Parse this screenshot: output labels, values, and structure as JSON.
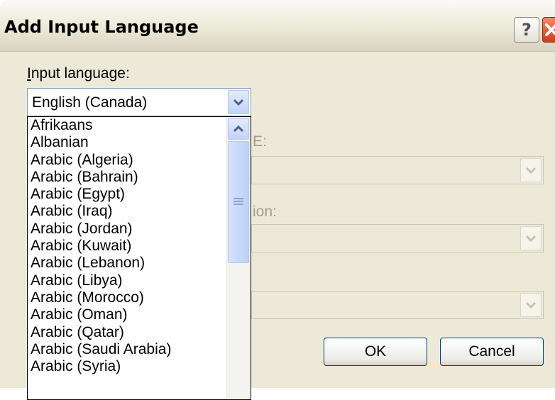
{
  "dialog": {
    "title": "Add Input Language",
    "help_button": "?"
  },
  "input_language": {
    "label_mnemonic": "I",
    "label_rest": "nput language:",
    "selected": "English (Canada)",
    "options": [
      "Afrikaans",
      "Albanian",
      "Arabic (Algeria)",
      "Arabic (Bahrain)",
      "Arabic (Egypt)",
      "Arabic (Iraq)",
      "Arabic (Jordan)",
      "Arabic (Kuwait)",
      "Arabic (Lebanon)",
      "Arabic (Libya)",
      "Arabic (Morocco)",
      "Arabic (Oman)",
      "Arabic (Qatar)",
      "Arabic (Saudi Arabia)",
      "Arabic (Syria)"
    ]
  },
  "partial_labels": {
    "first": "E:",
    "second": "ion:"
  },
  "buttons": {
    "ok": "OK",
    "cancel": "Cancel"
  }
}
